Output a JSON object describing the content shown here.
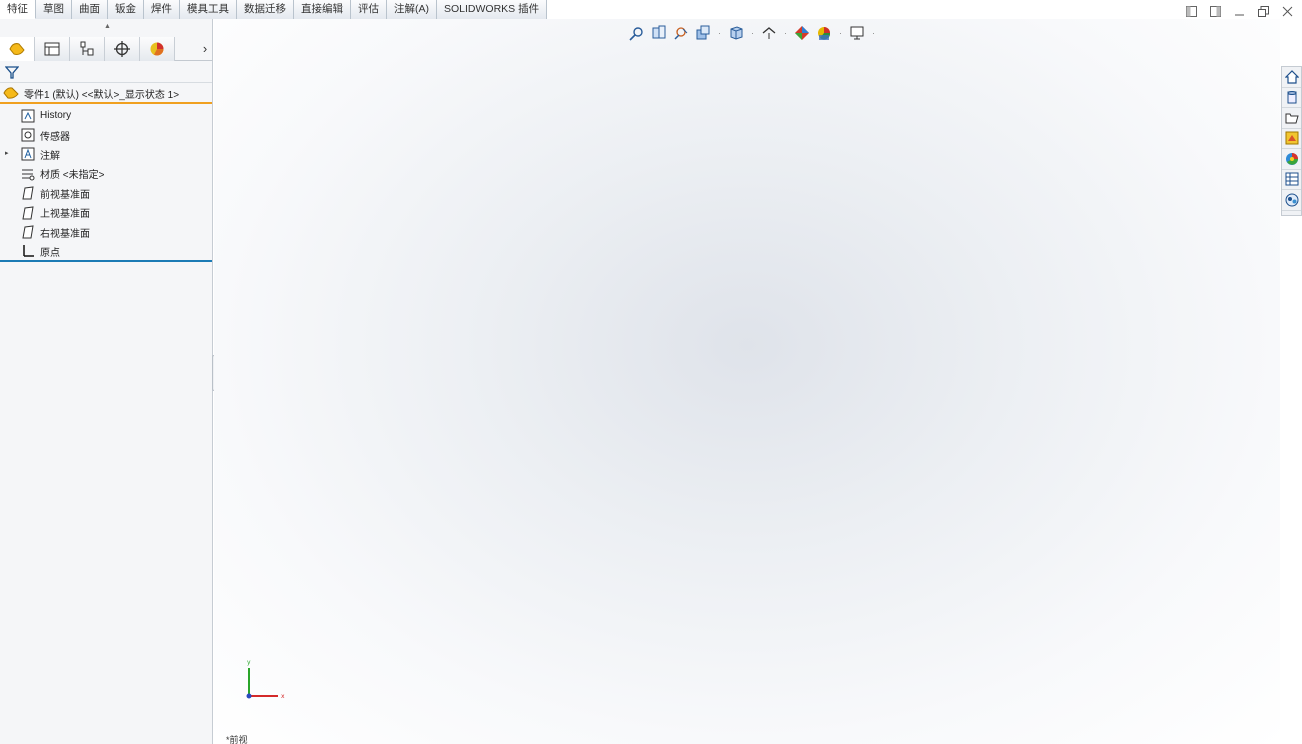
{
  "command_tabs": [
    {
      "label": "特征",
      "active": true
    },
    {
      "label": "草图"
    },
    {
      "label": "曲面"
    },
    {
      "label": "钣金"
    },
    {
      "label": "焊件"
    },
    {
      "label": "模具工具"
    },
    {
      "label": "数据迁移"
    },
    {
      "label": "直接编辑"
    },
    {
      "label": "评估"
    },
    {
      "label": "注解(A)"
    },
    {
      "label": "SOLIDWORKS 插件"
    }
  ],
  "feature_tree": {
    "root_label": "零件1 (默认) <<默认>_显示状态 1>",
    "items": [
      {
        "label": "History",
        "icon": "history-icon",
        "expandable": false
      },
      {
        "label": "传感器",
        "icon": "sensor-icon",
        "expandable": false
      },
      {
        "label": "注解",
        "icon": "annotation-icon",
        "expandable": true
      },
      {
        "label": "材质 <未指定>",
        "icon": "material-icon",
        "expandable": false
      },
      {
        "label": "前视基准面",
        "icon": "plane-icon",
        "expandable": false
      },
      {
        "label": "上视基准面",
        "icon": "plane-icon",
        "expandable": false
      },
      {
        "label": "右视基准面",
        "icon": "plane-icon",
        "expandable": false
      },
      {
        "label": "原点",
        "icon": "origin-icon",
        "expandable": false
      }
    ]
  },
  "viewport": {
    "view_label": "*前视"
  },
  "triad": {
    "x_label": "x",
    "y_label": "y"
  }
}
